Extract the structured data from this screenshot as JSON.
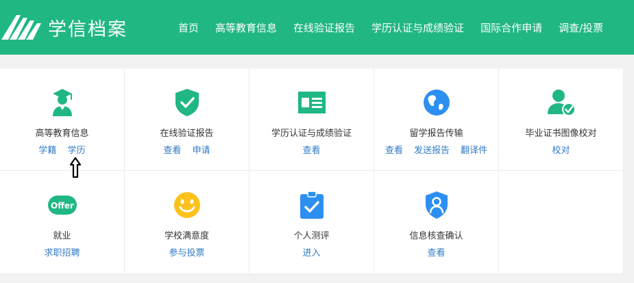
{
  "header": {
    "logo_text": "学信档案",
    "nav": [
      "首页",
      "高等教育信息",
      "在线验证报告",
      "学历认证与成绩验证",
      "国际合作申请",
      "调查/投票"
    ]
  },
  "services": [
    {
      "title": "高等教育信息",
      "icon": "graduate-icon",
      "links": [
        "学籍",
        "学历"
      ]
    },
    {
      "title": "在线验证报告",
      "icon": "shield-check-icon",
      "links": [
        "查看",
        "申请"
      ]
    },
    {
      "title": "学历认证与成绩验证",
      "icon": "id-card-icon",
      "links": [
        "查看"
      ]
    },
    {
      "title": "留学报告传输",
      "icon": "globe-icon",
      "links": [
        "查看",
        "发送报告",
        "翻译件"
      ]
    },
    {
      "title": "毕业证书图像校对",
      "icon": "user-check-icon",
      "links": [
        "校对"
      ]
    },
    {
      "title": "就业",
      "icon": "offer-icon",
      "icon_text": "Offer",
      "links": [
        "求职招聘"
      ]
    },
    {
      "title": "学校满意度",
      "icon": "smiley-icon",
      "links": [
        "参与投票"
      ]
    },
    {
      "title": "个人测评",
      "icon": "clipboard-check-icon",
      "links": [
        "进入"
      ]
    },
    {
      "title": "信息核查确认",
      "icon": "shield-user-icon",
      "links": [
        "查看"
      ]
    }
  ],
  "colors": {
    "brand": "#20b783",
    "link": "#2f7ac8",
    "blue_icon": "#2d8ff0",
    "yellow_icon": "#fcc21b"
  }
}
